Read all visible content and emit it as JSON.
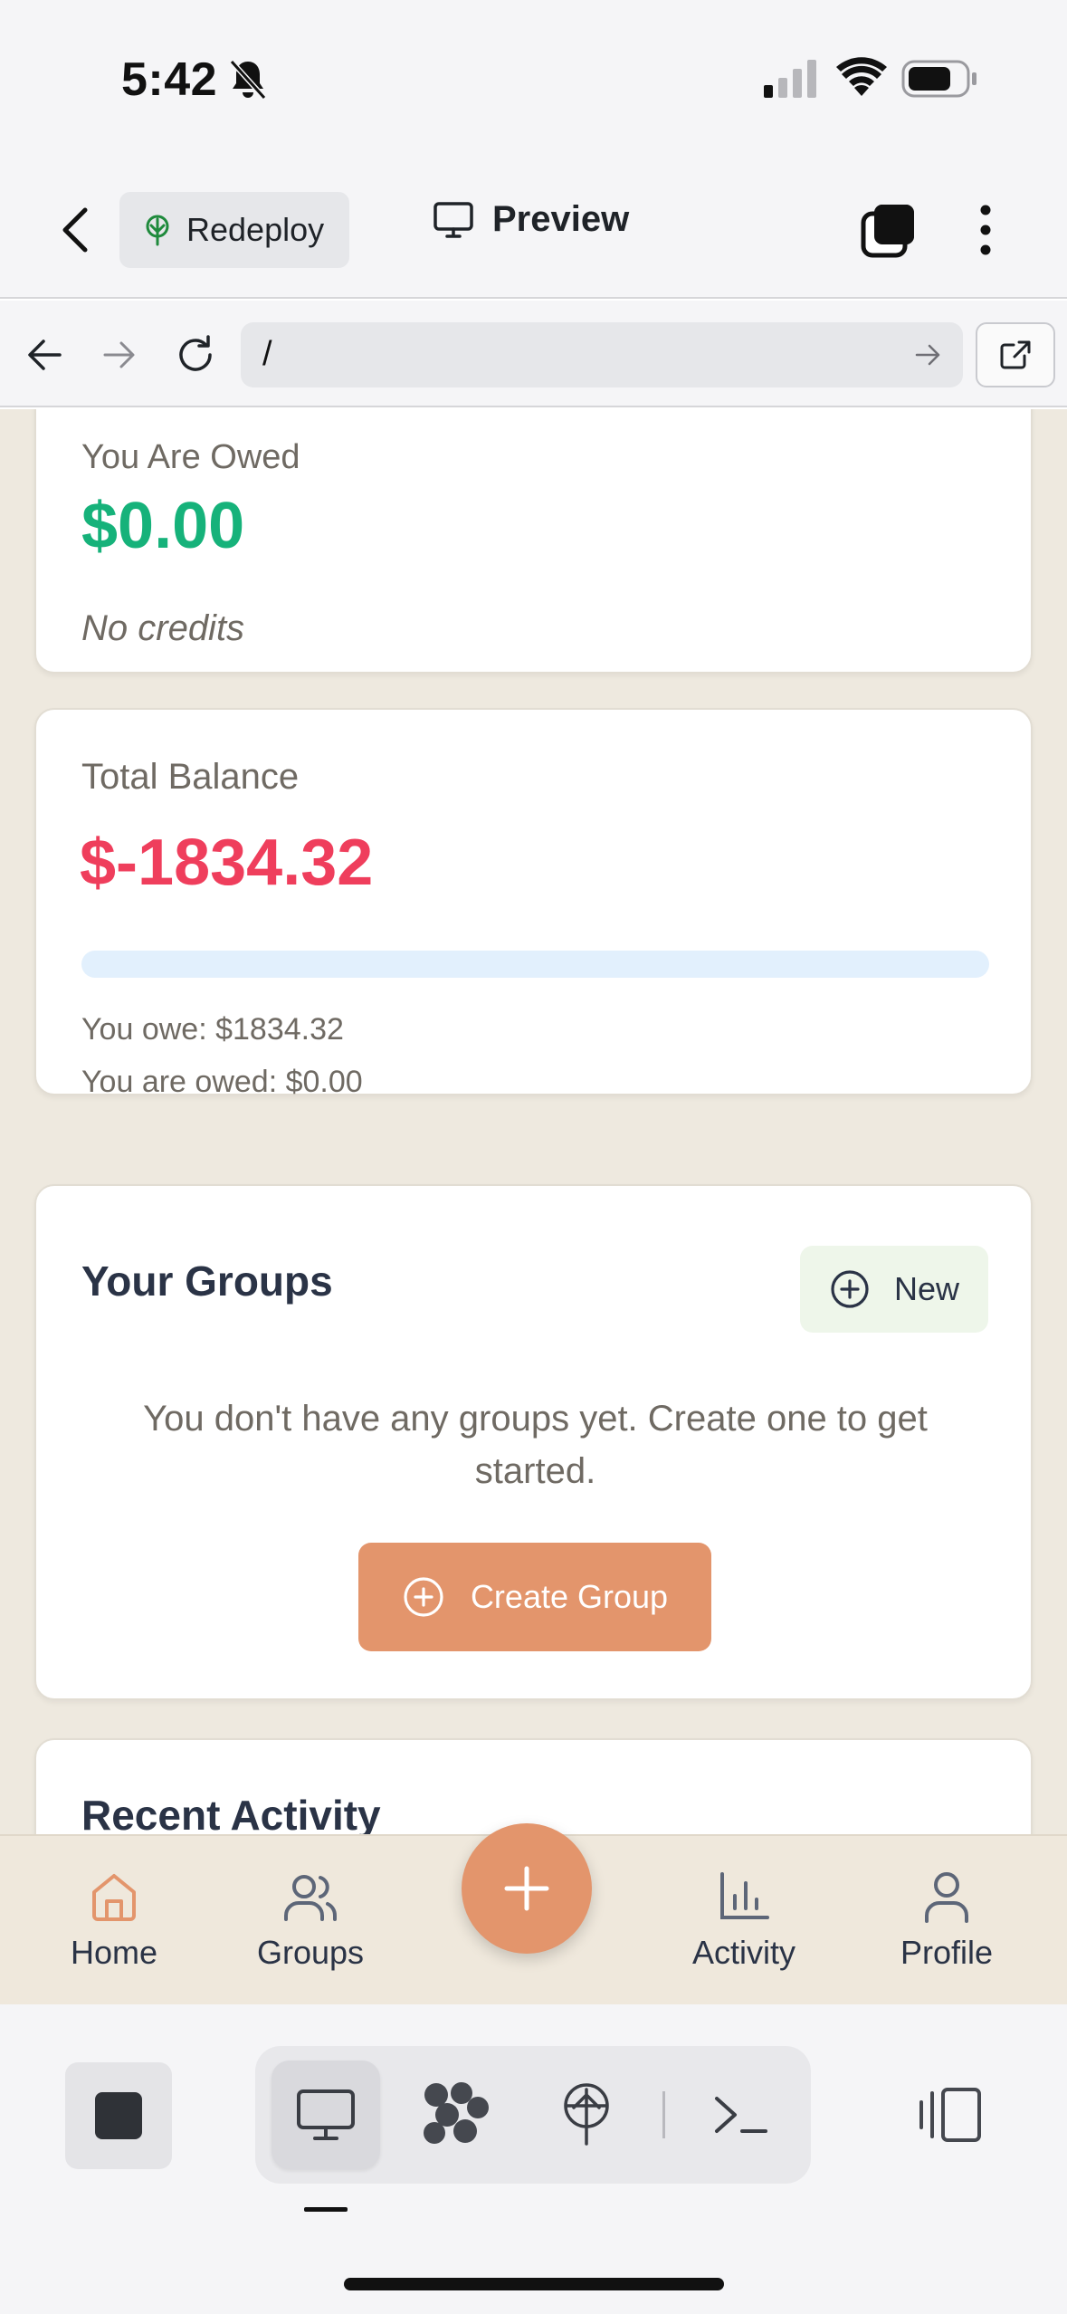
{
  "status_bar": {
    "time": "5:42"
  },
  "header": {
    "redeploy_label": "Redeploy",
    "preview_label": "Preview"
  },
  "url_bar": {
    "value": "/"
  },
  "cards": {
    "owed": {
      "title": "You Are Owed",
      "amount": "$0.00",
      "note": "No credits"
    },
    "balance": {
      "title": "Total Balance",
      "amount": "$-1834.32",
      "progress": 0,
      "owe_line": "You owe: $1834.32",
      "owed_line": "You are owed: $0.00"
    },
    "groups": {
      "title": "Your Groups",
      "new_label": "New",
      "empty_message": "You don't have any groups yet. Create one to get started.",
      "create_label": "Create Group"
    },
    "recent": {
      "title": "Recent Activity"
    }
  },
  "bottom_nav": {
    "home": "Home",
    "groups": "Groups",
    "activity": "Activity",
    "profile": "Profile"
  },
  "colors": {
    "accent": "#e3956c",
    "positive": "#16b27a",
    "negative": "#ef3e5c",
    "background": "#eee9df"
  },
  "icons": {
    "status_bar": [
      "bell-slash-icon",
      "cellular-signal-icon",
      "wifi-icon",
      "battery-icon"
    ],
    "header": [
      "back-chevron-icon",
      "deploy-tree-icon",
      "monitor-icon",
      "tabs-stack-icon",
      "more-vertical-icon"
    ],
    "url_bar": [
      "back-arrow-icon",
      "forward-arrow-icon",
      "reload-icon",
      "go-arrow-icon",
      "open-external-icon"
    ],
    "nav": [
      "home-icon",
      "users-icon",
      "plus-icon",
      "bar-chart-icon",
      "user-icon"
    ],
    "toolbar": [
      "stop-icon",
      "monitor-icon",
      "apps-icon",
      "deploy-icon",
      "terminal-icon",
      "panel-toggle-icon"
    ]
  }
}
